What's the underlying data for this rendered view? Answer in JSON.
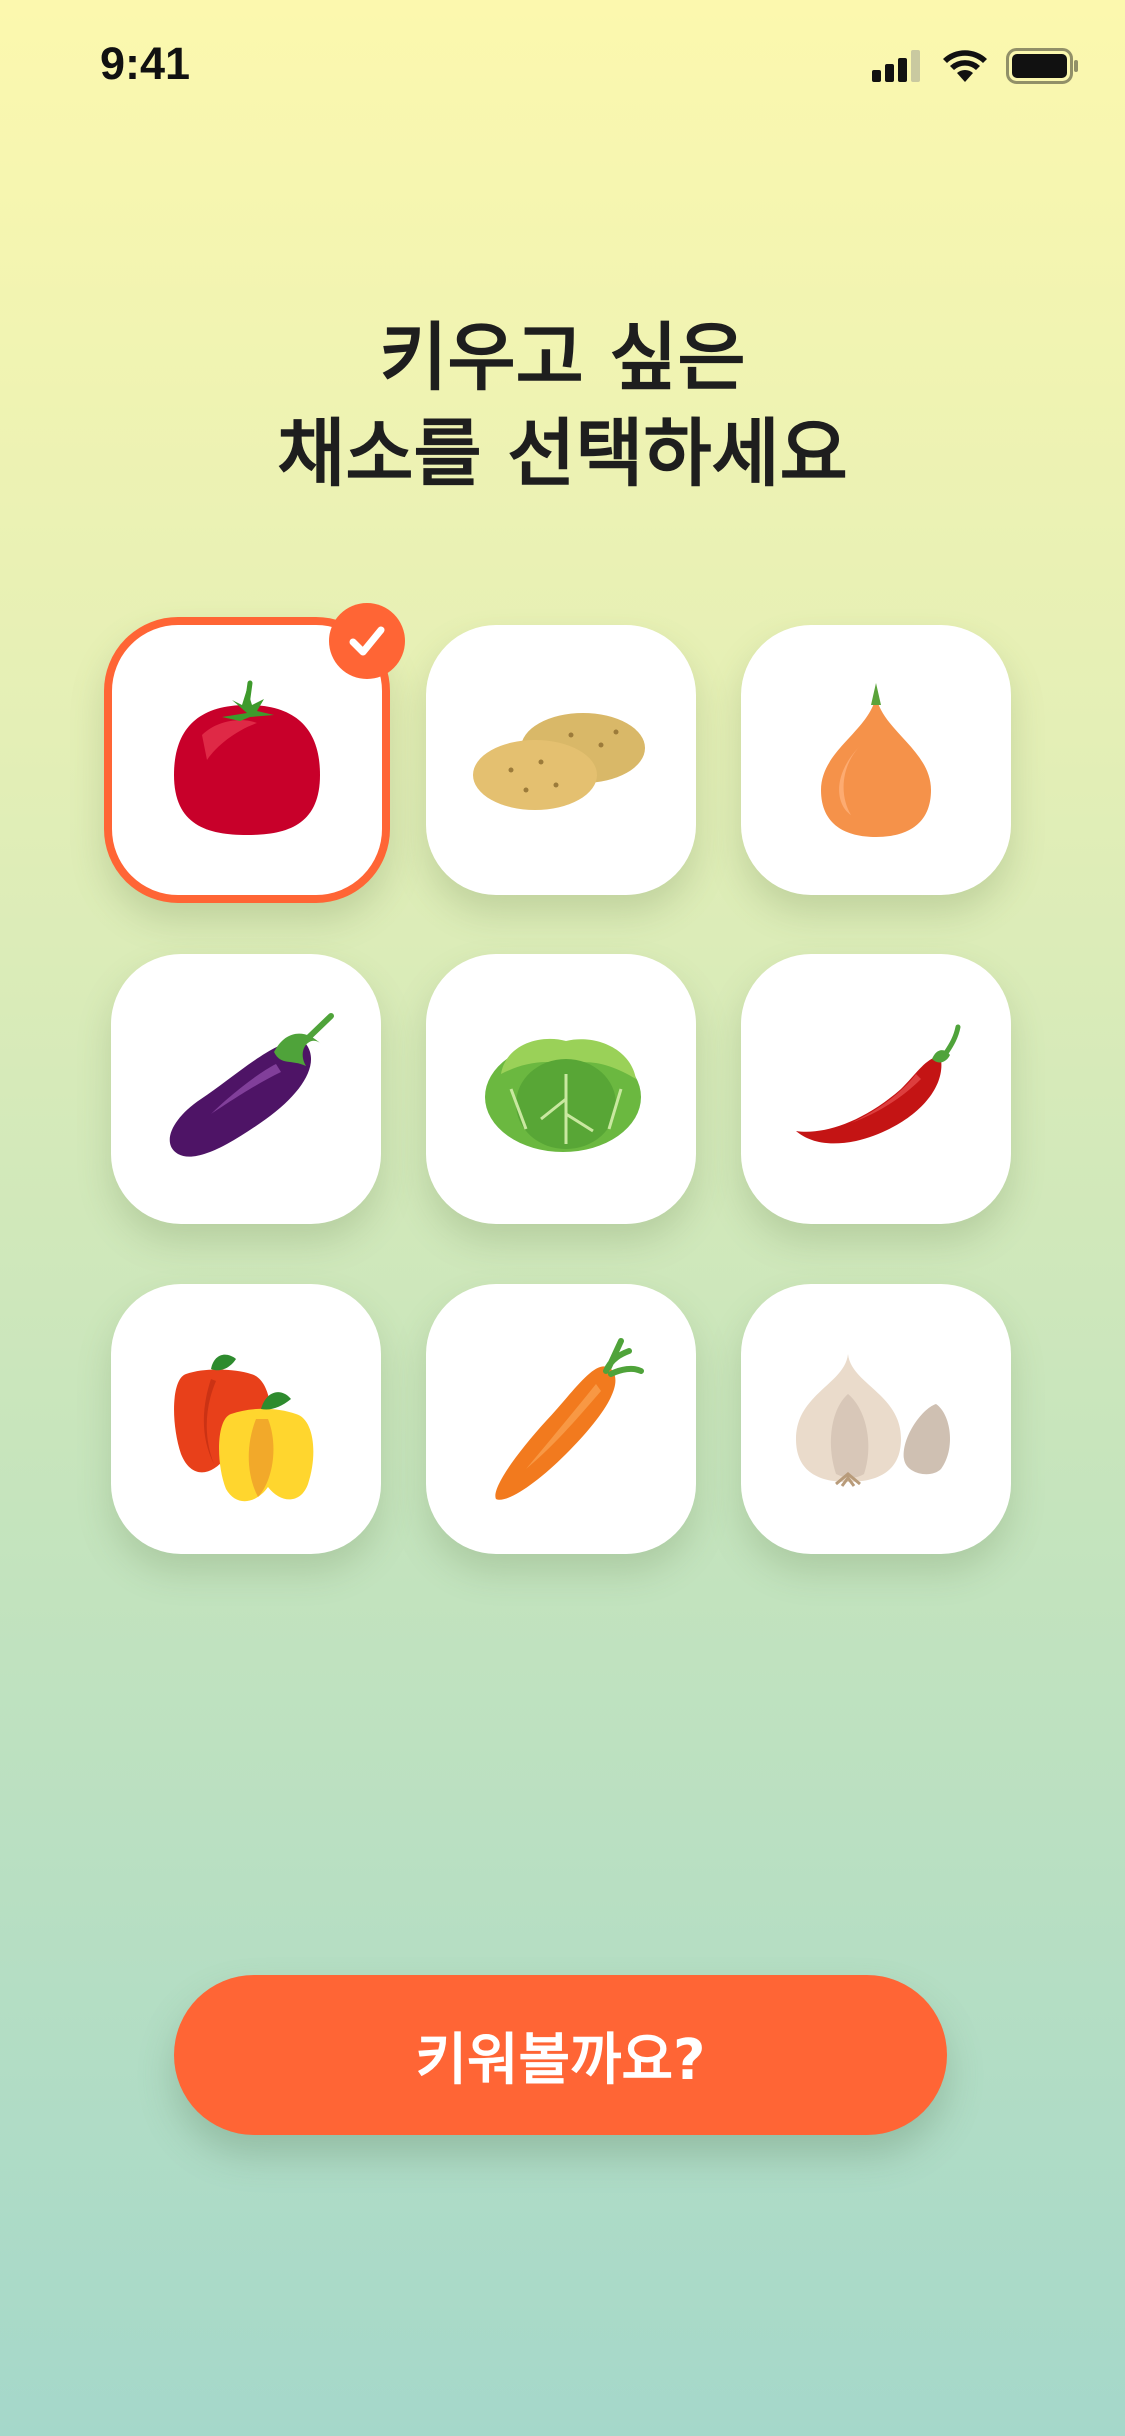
{
  "status_bar": {
    "time": "9:41",
    "signal_icon": "cellular-signal-icon",
    "wifi_icon": "wifi-icon",
    "battery_icon": "battery-icon"
  },
  "header": {
    "title_line1": "키우고 싶은",
    "title_line2": "채소를 선택하세요"
  },
  "vegetables": [
    {
      "icon": "tomato-icon",
      "selected": true
    },
    {
      "icon": "potato-icon",
      "selected": false
    },
    {
      "icon": "onion-icon",
      "selected": false
    },
    {
      "icon": "eggplant-icon",
      "selected": false
    },
    {
      "icon": "cabbage-icon",
      "selected": false
    },
    {
      "icon": "chili-pepper-icon",
      "selected": false
    },
    {
      "icon": "bell-pepper-icon",
      "selected": false
    },
    {
      "icon": "carrot-icon",
      "selected": false
    },
    {
      "icon": "garlic-icon",
      "selected": false
    }
  ],
  "cta": {
    "label": "키워볼까요?"
  },
  "colors": {
    "accent": "#FF6535",
    "tile_bg": "#FFFFFF",
    "bg_top": "#FCF8AE",
    "bg_bottom": "#A5D8CA"
  }
}
